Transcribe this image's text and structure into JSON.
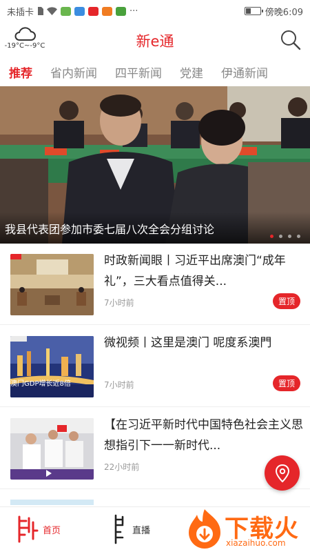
{
  "status_bar": {
    "carrier": "未插卡",
    "overflow": "···",
    "time": "傍晚6:09",
    "battery_level": 0.4
  },
  "header": {
    "weather_icon": "cloud-icon",
    "temperature": "-19°C~-9°C",
    "title": "新e通",
    "search_icon": "search-icon"
  },
  "tabs": [
    {
      "label": "推荐",
      "active": true
    },
    {
      "label": "省内新闻"
    },
    {
      "label": "四平新闻"
    },
    {
      "label": "党建"
    },
    {
      "label": "伊通新闻"
    }
  ],
  "hero": {
    "caption": "我县代表团参加市委七届八次全会分组讨论",
    "slide_count": 4,
    "active_slide": 1
  },
  "news": [
    {
      "title": "时政新闻眼丨习近平出席澳门“成年礼”，三大看点值得关...",
      "time": "7小时前",
      "pin": "置顶"
    },
    {
      "title": "微视频丨这里是澳门 呢度系澳門",
      "time": "7小时前",
      "pin": "置顶"
    },
    {
      "title": "【在习近平新时代中国特色社会主义思想指引下一一新时代...",
      "time": "22小时前"
    }
  ],
  "thumb_text": {
    "macau_gdp": "澳门GDP增长近8倍"
  },
  "fab_icon": "location-pin-icon",
  "bottom_nav": {
    "home_label": "首页",
    "live_label": "直播"
  },
  "watermark": {
    "text": "下载火",
    "sub": "xiazaihuo.com"
  },
  "colors": {
    "accent": "#e5262a",
    "watermark": "#ff6a13"
  }
}
